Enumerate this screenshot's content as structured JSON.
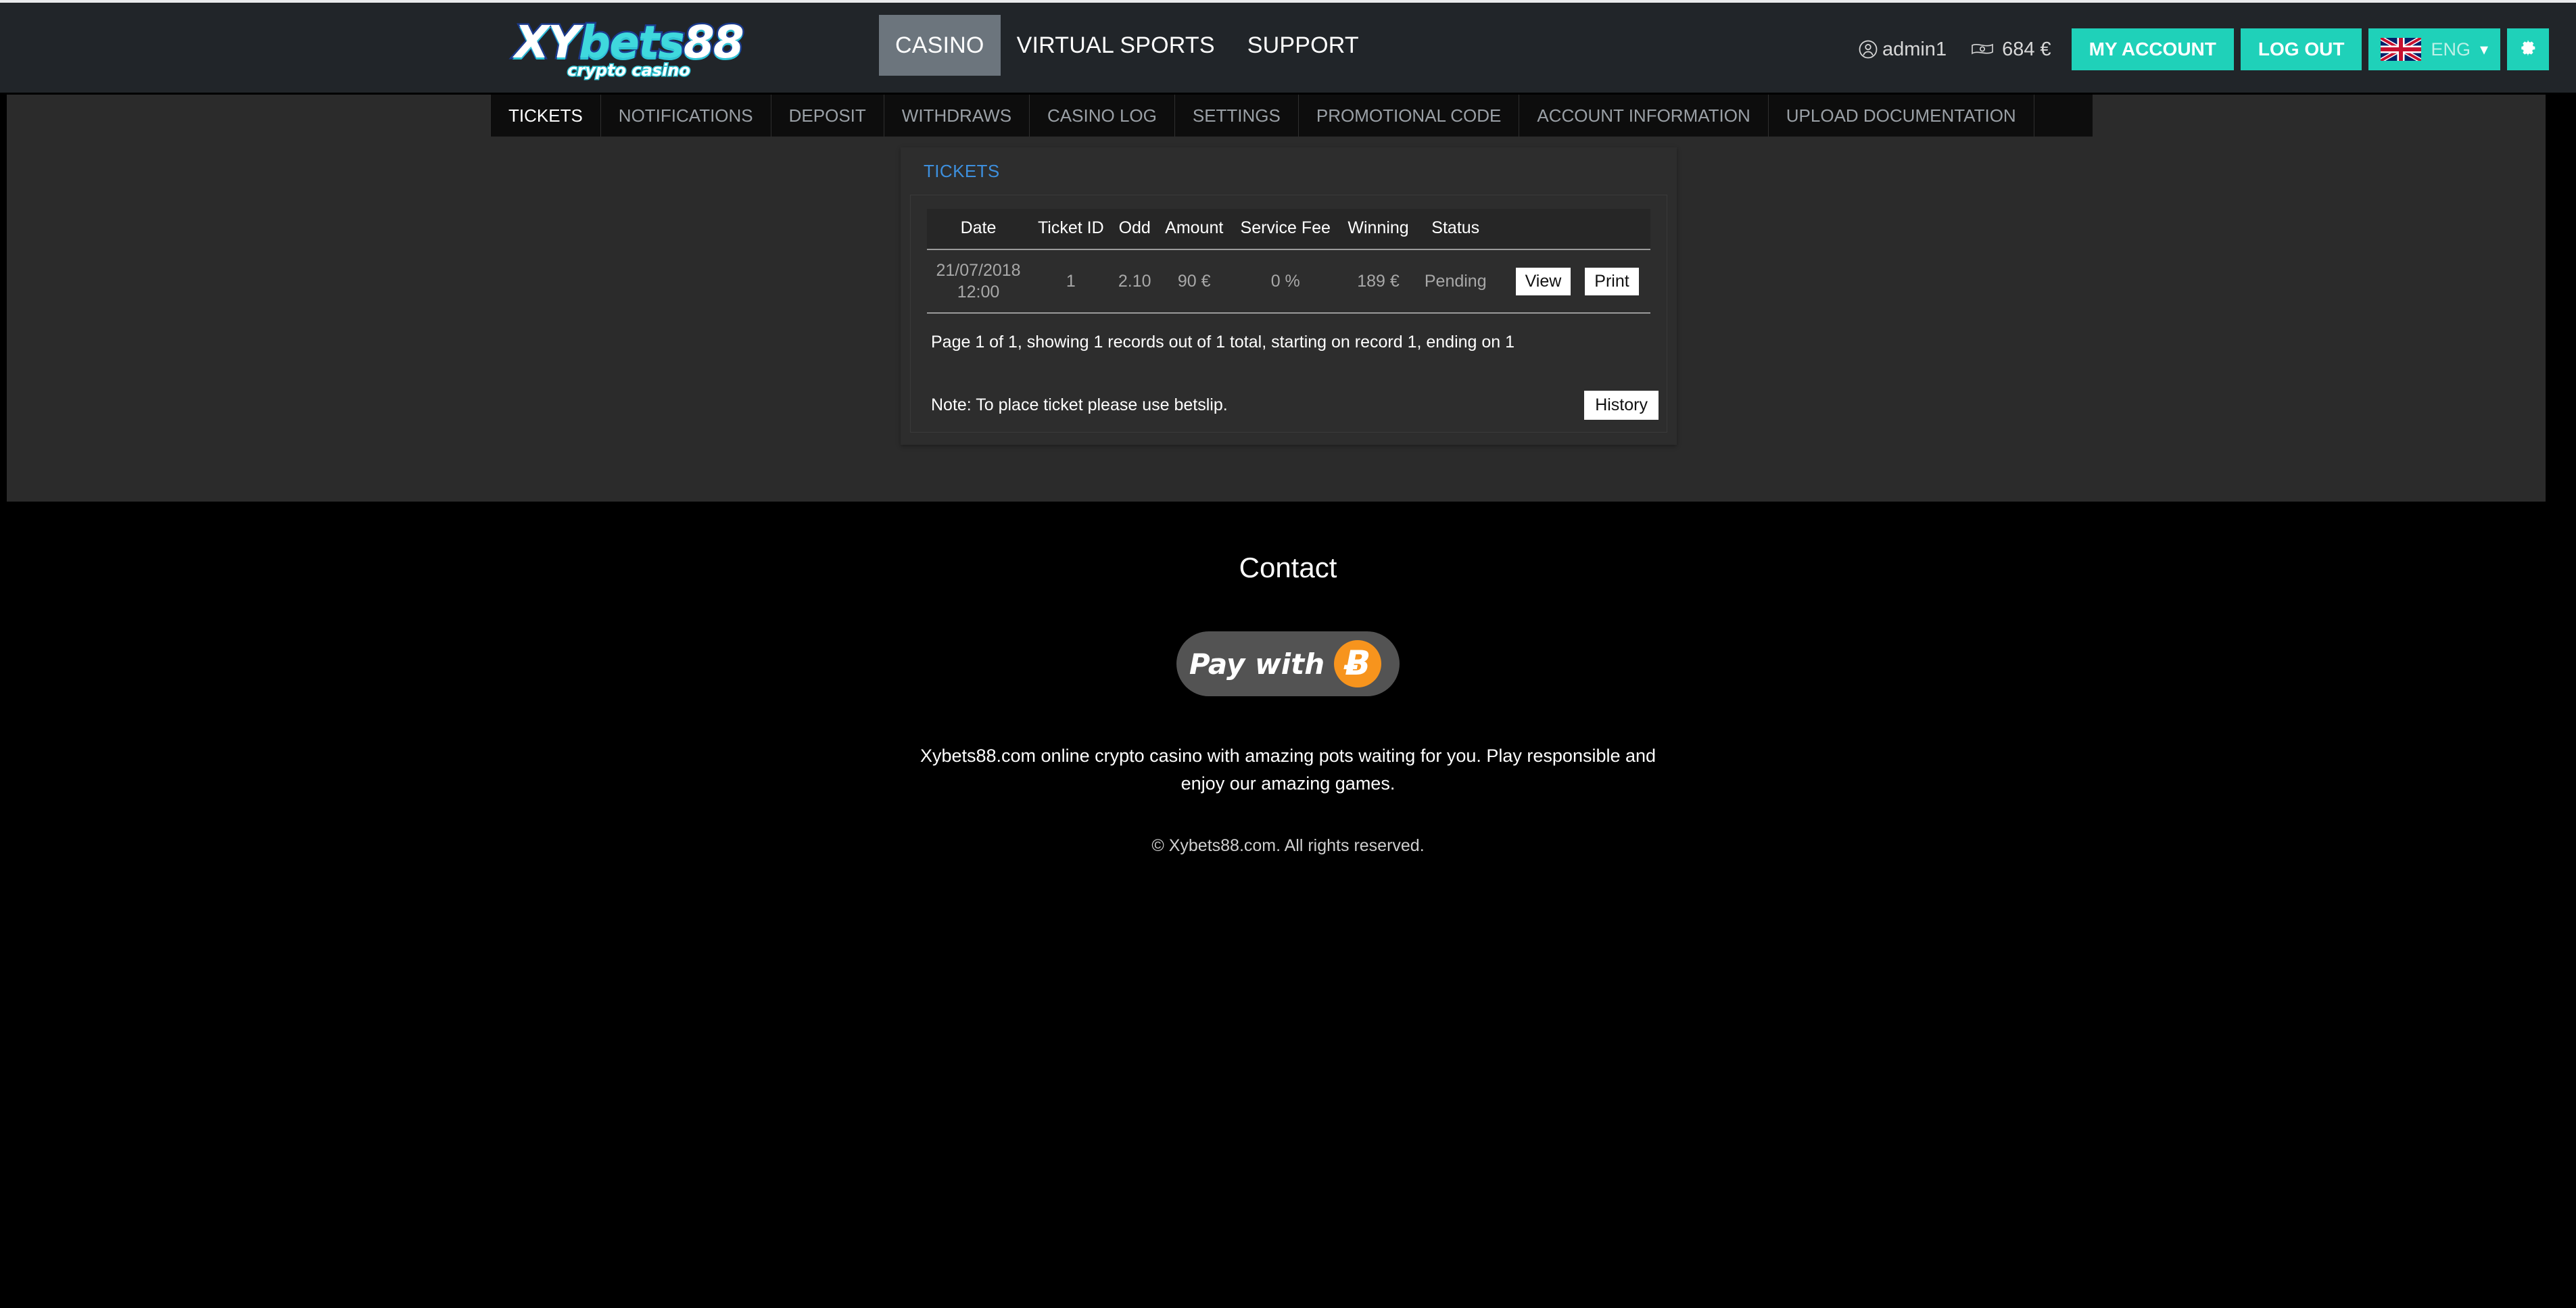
{
  "brand": {
    "logo_part1": "XY",
    "logo_part2": "bets",
    "logo_part3": "88",
    "logo_tagline": "crypto casino",
    "accent_teal": "#1fd1b9",
    "accent_blue": "#3d8fdd",
    "logo_cyan": "#3fd8dd"
  },
  "header": {
    "nav": [
      {
        "label": "CASINO",
        "active": true
      },
      {
        "label": "VIRTUAL SPORTS",
        "active": false
      },
      {
        "label": "SUPPORT",
        "active": false
      }
    ],
    "account": {
      "user_icon": "user-circle-icon",
      "username": "admin1",
      "balance_icon": "money-note-icon",
      "balance": "684 €",
      "my_account_label": "MY ACCOUNT",
      "log_out_label": "LOG OUT",
      "language_flag": "uk-flag-icon",
      "language_label": "ENG",
      "language_caret": "chevron-down-icon",
      "settings_icon": "gear-icon"
    }
  },
  "subnav": {
    "items": [
      {
        "label": "TICKETS",
        "active": true
      },
      {
        "label": "NOTIFICATIONS",
        "active": false
      },
      {
        "label": "DEPOSIT",
        "active": false
      },
      {
        "label": "WITHDRAWS",
        "active": false
      },
      {
        "label": "CASINO LOG",
        "active": false
      },
      {
        "label": "SETTINGS",
        "active": false
      },
      {
        "label": "PROMOTIONAL CODE",
        "active": false
      },
      {
        "label": "ACCOUNT INFORMATION",
        "active": false
      },
      {
        "label": "UPLOAD DOCUMENTATION",
        "active": false
      }
    ]
  },
  "tickets_panel": {
    "title": "TICKETS",
    "columns": [
      "Date",
      "Ticket ID",
      "Odd",
      "Amount",
      "Service Fee",
      "Winning",
      "Status",
      ""
    ],
    "rows": [
      {
        "date_line1": "21/07/2018",
        "date_line2": "12:00",
        "ticket_id": "1",
        "odd": "2.10",
        "amount": "90 €",
        "service_fee": "0 %",
        "winning": "189 €",
        "status": "Pending",
        "view_label": "View",
        "print_label": "Print"
      }
    ],
    "pager_text": "Page 1 of 1, showing 1 records out of 1 total, starting on record 1, ending on 1",
    "note_text": "Note: To place ticket please use betslip.",
    "history_label": "History"
  },
  "footer": {
    "contact_title": "Contact",
    "pay_with_text": "Pay with",
    "bitcoin_glyph": "Ƀ",
    "description": "Xybets88.com online crypto casino with amazing pots waiting for you. Play responsible and enjoy our amazing games.",
    "copyright": "© Xybets88.com. All rights reserved."
  }
}
